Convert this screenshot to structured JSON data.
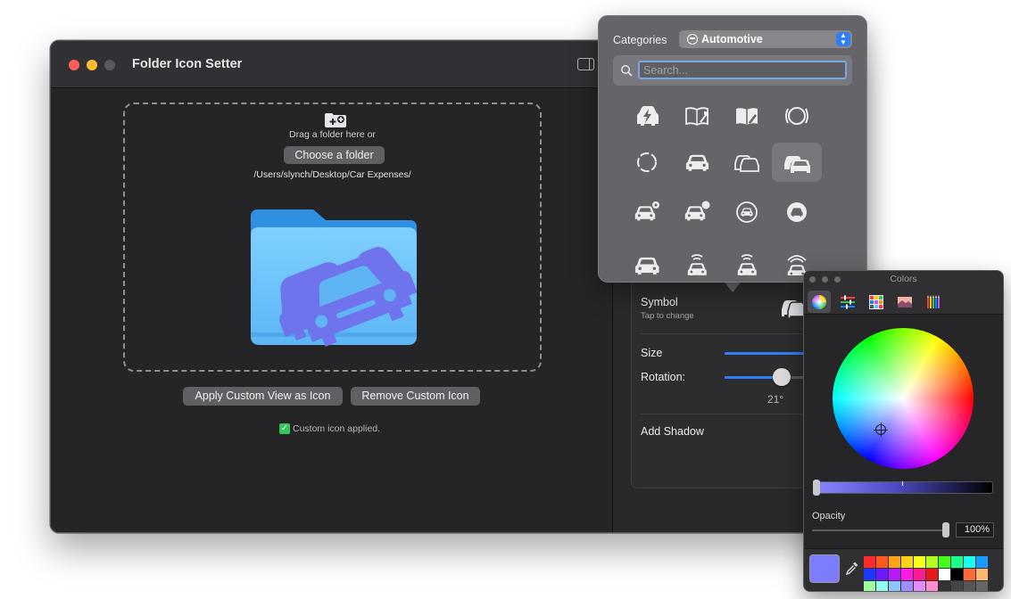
{
  "window": {
    "title": "Folder Icon Setter"
  },
  "drop_zone": {
    "hint": "Drag a folder here or",
    "choose_button": "Choose a folder",
    "path": "/Users/slynch/Desktop/Car Expenses/"
  },
  "actions": {
    "apply_label": "Apply Custom View as Icon",
    "remove_label": "Remove Custom Icon",
    "status": "Custom icon applied."
  },
  "settings": {
    "symbol_label": "Symbol",
    "symbol_sub": "Tap to change",
    "size_label": "Size",
    "size_value": 1.0,
    "rotation_label": "Rotation:",
    "rotation_value": "21°",
    "shadow_label": "Add Shadow"
  },
  "picker": {
    "categories_label": "Categories",
    "category": "Automotive",
    "search_placeholder": "Search...",
    "symbols": [
      "bolt-car",
      "book-wrench",
      "book-wrench-fill",
      "tire-pressure",
      "tire",
      "car",
      "two-cars-outline",
      "two-cars-fill",
      "car-gear",
      "car-gear-fill",
      "car-circle",
      "car-circle-fill",
      "car-front",
      "car-waves-up",
      "car-waves-up-fill",
      "car-signal"
    ],
    "selected_index": 7
  },
  "colors_panel": {
    "title": "Colors",
    "opacity_label": "Opacity",
    "opacity_value": "100%",
    "current_color": "#7c7cfc",
    "tabs": [
      "color-wheel",
      "sliders",
      "palettes",
      "image-palettes",
      "pencils"
    ],
    "swatches": [
      "#ff2a2a",
      "#ff5a1e",
      "#ffa31a",
      "#ffd21a",
      "#f7ff1a",
      "#b4ff1a",
      "#43ff1a",
      "#1aff8c",
      "#1affef",
      "#1a9bff",
      "#1a3bff",
      "#6b1aff",
      "#b51aff",
      "#ff1ae6",
      "#ff1a96",
      "#e61a1a",
      "#ffffff",
      "#000000",
      "#ff6a3a",
      "#ffb870",
      "#9effa0",
      "#8effea",
      "#8ec4ff",
      "#a08eff",
      "#e38eff",
      "#ff8ed0",
      "#333333",
      "#444444",
      "#555555",
      "#666666"
    ]
  }
}
